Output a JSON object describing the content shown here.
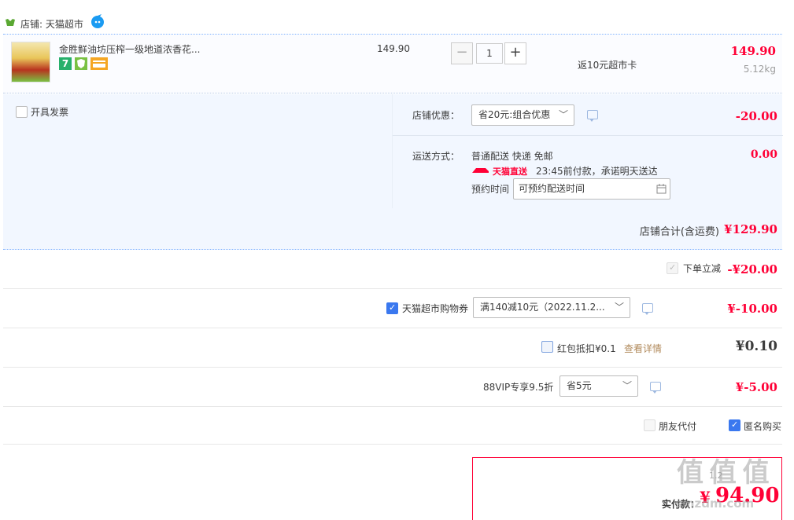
{
  "shop": {
    "label": "店铺: 天猫超市"
  },
  "item": {
    "title": "金胜鲜油坊压榨一级地道浓香花...",
    "price": "149.90",
    "quantity": "1",
    "minus": "−",
    "plus": "+",
    "card_note": "返10元超市卡",
    "subtotal": "149.90",
    "weight": "5.12kg",
    "badge_7": "7"
  },
  "invoice": {
    "label": "开具发票"
  },
  "discount": {
    "label": "店铺优惠：",
    "selected": "省20元:组合优惠",
    "amount": "-20.00"
  },
  "shipping": {
    "label": "运送方式：",
    "method": "普通配送 快递 免邮",
    "amount": "0.00",
    "express_logo": "天猫直送",
    "promise": "23:45前付款，承诺明天送达",
    "appt_label": "预约时间",
    "appt_placeholder": "可预约配送时间"
  },
  "shop_total": {
    "label": "店铺合计(含运费)",
    "amount": "¥129.90"
  },
  "instant_discount": {
    "label": "下单立减",
    "amount": "-¥20.00"
  },
  "coupon": {
    "label": "天猫超市购物券",
    "selected": "满140减10元（2022.11.2...",
    "amount": "¥-10.00"
  },
  "redpacket": {
    "label": "红包抵扣¥0.1",
    "link": "查看详情",
    "amount": "¥0.10"
  },
  "vip": {
    "label": "88VIP专享9.5折",
    "selected": "省5元",
    "amount": "¥-5.00"
  },
  "options": {
    "friend_pay": "朋友代付",
    "anonymous": "匿名购买"
  },
  "pay": {
    "label": "实付款：",
    "amount": "94.90",
    "currency": "¥",
    "partial": "1.2"
  },
  "watermark": {
    "text": "值 值 值",
    "sub": "smzdm.com"
  },
  "colors": {
    "price_red": "#ff0036",
    "accent_blue": "#3a78ef",
    "row_bg": "#f2f7ff"
  }
}
